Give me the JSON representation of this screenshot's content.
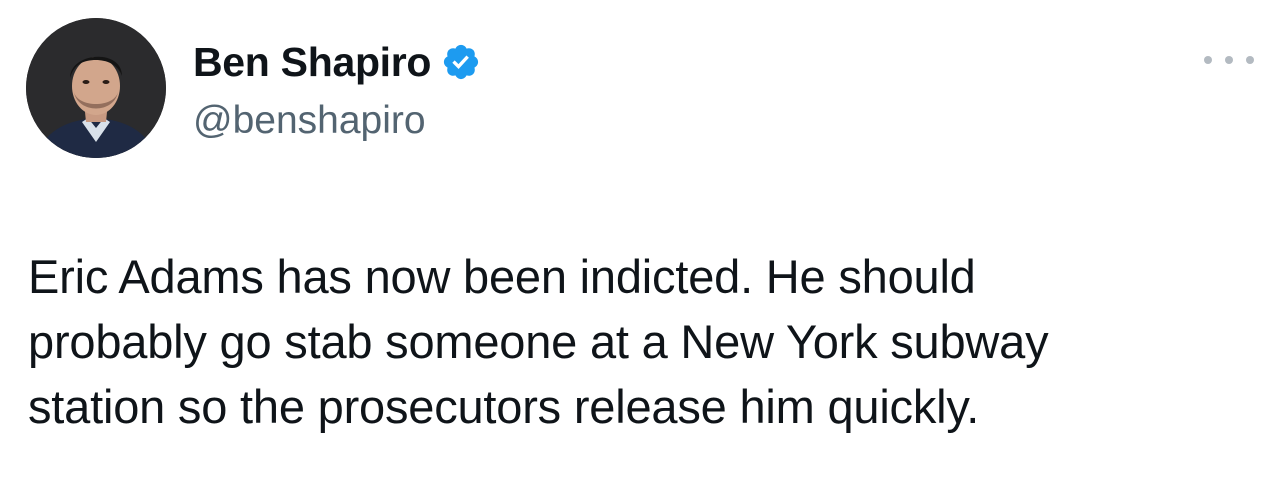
{
  "author": {
    "display_name": "Ben Shapiro",
    "handle": "@benshapiro",
    "verified": true,
    "avatar_icon": "profile-photo"
  },
  "tweet": {
    "text_lines": [
      "Eric Adams has now been indicted. He should",
      "probably go stab someone at a New York subway",
      "station so the prosecutors release him quickly."
    ]
  },
  "icons": {
    "verified_badge": "verified-badge-icon",
    "more_menu": "more-options-icon"
  },
  "colors": {
    "verified_blue": "#1d9bf0",
    "text_primary": "#0f1419",
    "text_secondary": "#536471"
  }
}
